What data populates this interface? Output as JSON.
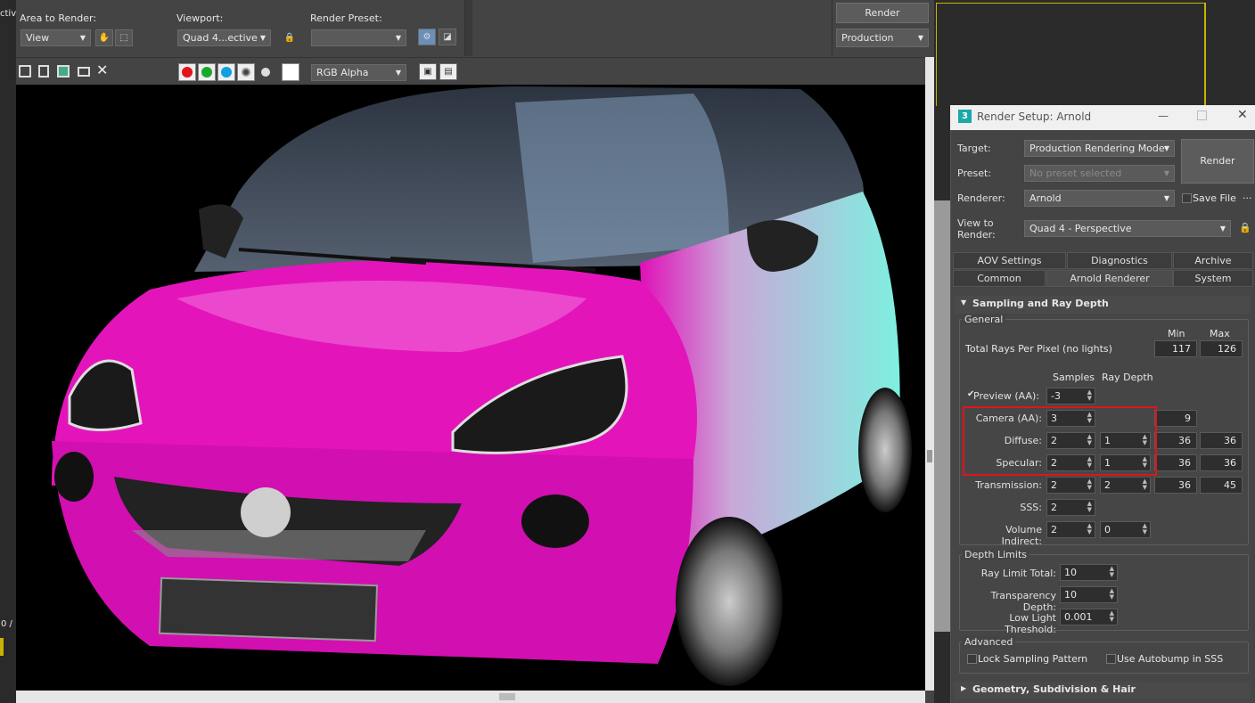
{
  "frame": {
    "area_label": "Area to Render:",
    "area_value": "View",
    "viewport_label": "Viewport:",
    "viewport_value": "Quad 4...ective",
    "preset_label": "Render Preset:",
    "preset_value": "",
    "render_button": "Render",
    "production_value": "Production",
    "channel_value": "RGB Alpha",
    "left_edge_text": "ctiv",
    "frame_counter": "0 /"
  },
  "dialog": {
    "title": "Render Setup: Arnold",
    "target_label": "Target:",
    "target_value": "Production Rendering Mode",
    "preset_label": "Preset:",
    "preset_value": "No preset selected",
    "renderer_label": "Renderer:",
    "renderer_value": "Arnold",
    "save_file": "Save File",
    "view_label": "View to\nRender:",
    "view_value": "Quad 4 - Perspective",
    "render_button": "Render",
    "tabs_row1": [
      "AOV Settings",
      "Diagnostics",
      "Archive"
    ],
    "tabs_row2": [
      "Common",
      "Arnold Renderer",
      "System"
    ],
    "rollout_title": "Sampling and Ray Depth",
    "general_label": "General",
    "min_label": "Min",
    "max_label": "Max",
    "total_rays_label": "Total Rays Per Pixel (no lights)",
    "total_rays_min": "117",
    "total_rays_max": "126",
    "samples_header": "Samples",
    "raydepth_header": "Ray Depth",
    "rows": [
      {
        "label": "Preview (AA):",
        "samples": "-3",
        "depth": "",
        "min": "",
        "max": ""
      },
      {
        "label": "Camera (AA):",
        "samples": "3",
        "depth": "",
        "min": "9",
        "max": ""
      },
      {
        "label": "Diffuse:",
        "samples": "2",
        "depth": "1",
        "min": "36",
        "max": "36"
      },
      {
        "label": "Specular:",
        "samples": "2",
        "depth": "1",
        "min": "36",
        "max": "36"
      },
      {
        "label": "Transmission:",
        "samples": "2",
        "depth": "2",
        "min": "36",
        "max": "45"
      },
      {
        "label": "SSS:",
        "samples": "2",
        "depth": "",
        "min": "",
        "max": ""
      },
      {
        "label": "Volume Indirect:",
        "samples": "2",
        "depth": "0",
        "min": "",
        "max": ""
      }
    ],
    "depth_limits_label": "Depth Limits",
    "ray_limit_label": "Ray Limit Total:",
    "ray_limit_value": "10",
    "transp_depth_label": "Transparency Depth:",
    "transp_depth_value": "10",
    "low_light_label": "Low Light Threshold:",
    "low_light_value": "0.001",
    "advanced_label": "Advanced",
    "lock_sampling": "Lock Sampling Pattern",
    "use_autobump": "Use Autobump in SSS",
    "geometry_rollout": "Geometry, Subdivision & Hair"
  },
  "colors": {
    "highlight_box": "#e0141c",
    "car_paint": "#e010b8",
    "accent_yellow": "#c8b400"
  }
}
